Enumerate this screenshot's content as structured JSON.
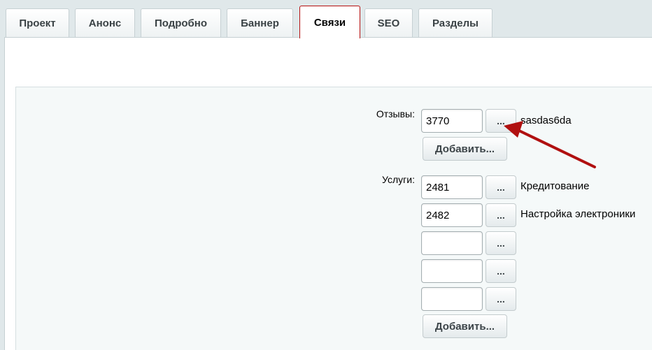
{
  "tabs": [
    {
      "label": "Проект"
    },
    {
      "label": "Анонс"
    },
    {
      "label": "Подробно"
    },
    {
      "label": "Баннер"
    },
    {
      "label": "Связи"
    },
    {
      "label": "SEO"
    },
    {
      "label": "Разделы"
    }
  ],
  "active_tab": "Связи",
  "reviews": {
    "label": "Отзывы:",
    "rows": [
      {
        "value": "3770",
        "button": "...",
        "name": "sasdas6da"
      }
    ],
    "add_label": "Добавить..."
  },
  "services": {
    "label": "Услуги:",
    "rows": [
      {
        "value": "2481",
        "button": "...",
        "name": "Кредитование"
      },
      {
        "value": "2482",
        "button": "...",
        "name": "Настройка электроники"
      },
      {
        "value": "",
        "button": "...",
        "name": ""
      },
      {
        "value": "",
        "button": "...",
        "name": ""
      },
      {
        "value": "",
        "button": "...",
        "name": ""
      }
    ],
    "add_label": "Добавить..."
  },
  "colors": {
    "active_tab_border": "#b50f0f",
    "annotation_arrow": "#b01010"
  }
}
